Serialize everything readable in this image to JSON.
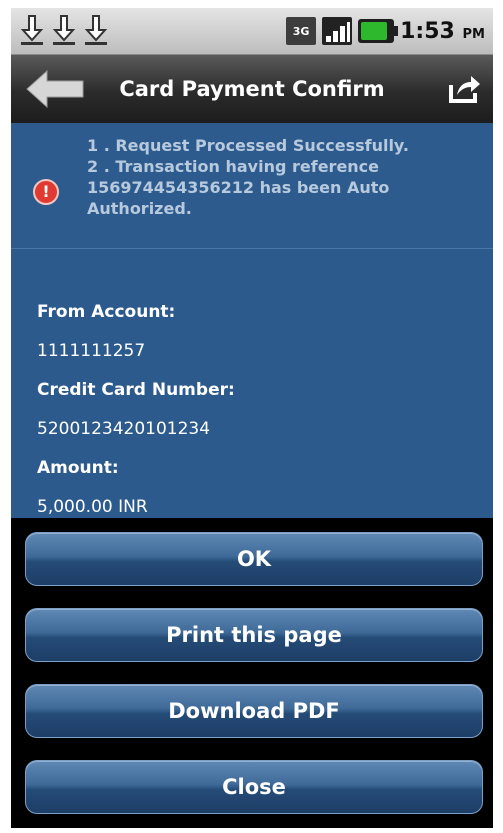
{
  "status_bar": {
    "icons": [
      "download-icon",
      "download-icon",
      "download-icon"
    ],
    "network": "3G",
    "time": "1:53",
    "ampm": "PM"
  },
  "header": {
    "title": "Card Payment Confirm",
    "back_icon": "back-arrow-icon",
    "share_icon": "share-icon"
  },
  "message": {
    "icon": "error-icon",
    "lines": [
      "1 . Request Processed Successfully.",
      "2 . Transaction having reference 156974454356212 has been Auto Authorized."
    ]
  },
  "details": {
    "from_account_label": "From Account:",
    "from_account_value": "1111111257",
    "card_number_label": "Credit Card Number:",
    "card_number_value": "5200123420101234",
    "amount_label": "Amount:",
    "amount_value": "5,000.00 INR"
  },
  "buttons": {
    "ok": "OK",
    "print": "Print this page",
    "download": "Download PDF",
    "close": "Close"
  },
  "colors": {
    "content_bg": "#2c5a8c",
    "button_top": "#5f88b4",
    "button_bottom": "#1d3e66",
    "error": "#e03a32"
  }
}
